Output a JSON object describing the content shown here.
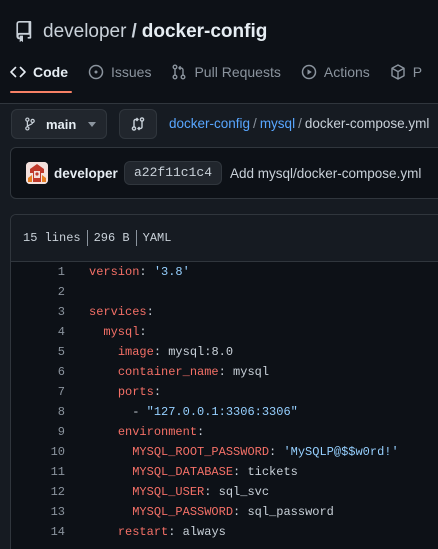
{
  "repo": {
    "owner": "developer",
    "separator": "/",
    "name": "docker-config"
  },
  "tabs": [
    {
      "label": "Code",
      "icon": "code-icon",
      "active": true
    },
    {
      "label": "Issues",
      "icon": "issue-icon"
    },
    {
      "label": "Pull Requests",
      "icon": "pull-request-icon"
    },
    {
      "label": "Actions",
      "icon": "play-icon"
    },
    {
      "label": "P",
      "icon": "package-icon"
    }
  ],
  "branch": {
    "name": "main"
  },
  "breadcrumb": {
    "root": "docker-config",
    "folder": "mysql",
    "file": "docker-compose.yml"
  },
  "commit": {
    "author": "developer",
    "sha": "a22f11c1c4",
    "message": "Add mysql/docker-compose.yml"
  },
  "file_info": {
    "lines": "15 lines",
    "size": "296 B",
    "lang": "YAML"
  },
  "code_lines": [
    {
      "n": "1",
      "indent": "",
      "key": "version",
      "sep": ": ",
      "val": "'3.8'",
      "val_type": "s"
    },
    {
      "n": "2",
      "indent": "",
      "key": "",
      "sep": "",
      "val": "",
      "val_type": ""
    },
    {
      "n": "3",
      "indent": "",
      "key": "services",
      "sep": ":",
      "val": "",
      "val_type": ""
    },
    {
      "n": "4",
      "indent": "  ",
      "key": "mysql",
      "sep": ":",
      "val": "",
      "val_type": ""
    },
    {
      "n": "5",
      "indent": "    ",
      "key": "image",
      "sep": ": ",
      "val": "mysql:8.0",
      "val_type": "p"
    },
    {
      "n": "6",
      "indent": "    ",
      "key": "container_name",
      "sep": ": ",
      "val": "mysql",
      "val_type": "p"
    },
    {
      "n": "7",
      "indent": "    ",
      "key": "ports",
      "sep": ":",
      "val": "",
      "val_type": ""
    },
    {
      "n": "8",
      "indent": "      ",
      "key": "",
      "sep": "- ",
      "val": "\"127.0.0.1:3306:3306\"",
      "val_type": "s"
    },
    {
      "n": "9",
      "indent": "    ",
      "key": "environment",
      "sep": ":",
      "val": "",
      "val_type": ""
    },
    {
      "n": "10",
      "indent": "      ",
      "key": "MYSQL_ROOT_PASSWORD",
      "sep": ": ",
      "val": "'MySQLP@$$w0rd!'",
      "val_type": "s"
    },
    {
      "n": "11",
      "indent": "      ",
      "key": "MYSQL_DATABASE",
      "sep": ": ",
      "val": "tickets",
      "val_type": "p"
    },
    {
      "n": "12",
      "indent": "      ",
      "key": "MYSQL_USER",
      "sep": ": ",
      "val": "sql_svc",
      "val_type": "p"
    },
    {
      "n": "13",
      "indent": "      ",
      "key": "MYSQL_PASSWORD",
      "sep": ": ",
      "val": "sql_password",
      "val_type": "p"
    },
    {
      "n": "14",
      "indent": "    ",
      "key": "restart",
      "sep": ": ",
      "val": "always",
      "val_type": "p"
    }
  ]
}
